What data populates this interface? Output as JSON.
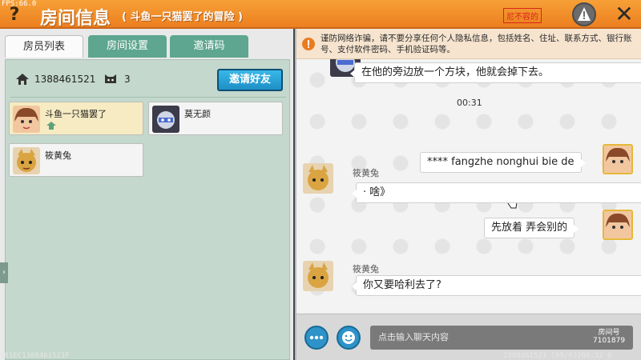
{
  "fps": "FPS:66.0",
  "header": {
    "help_icon": "help-icon",
    "title": "房间信息",
    "subtitle": "( 斗鱼一只猫罢了的冒险 )",
    "link_label": "尼不容的",
    "warn_icon": "warning-icon",
    "close_icon": "close-icon",
    "accent": "#f39a2e"
  },
  "tabs": [
    {
      "label": "房员列表"
    },
    {
      "label": "房间设置"
    },
    {
      "label": "邀请码"
    }
  ],
  "room": {
    "id": "1388461521",
    "count": "3",
    "invite_label": "邀请好友"
  },
  "members": [
    {
      "name": "斗鱼一只猫罢了",
      "role": "owner"
    },
    {
      "name": "莫无颜",
      "role": "member"
    },
    {
      "name": "筱黄兔",
      "role": "member"
    }
  ],
  "notice": "谨防网络诈骗，请不要分享任何个人隐私信息，包括姓名、住址、联系方式、银行账号、支付软件密码、手机验证码等。",
  "messages": [
    {
      "text": "在他的旁边放一个方块，他就会掉下去。"
    },
    {
      "time": "00:31"
    },
    {
      "text": "**** fangzhe  nonghui bie de"
    },
    {
      "sender": "筱黄兔",
      "text": "· 啥》"
    },
    {
      "text": "先放着 弄会别的"
    },
    {
      "sender": "筱黄兔",
      "text": "你又要哈利去了?"
    }
  ],
  "input": {
    "placeholder": "点击输入聊天内容",
    "watermark_top": "房间号",
    "watermark_id": "7101879"
  },
  "footer": {
    "left": "O81EC1388461521F",
    "right": "1388461521  [09/03]00:32 0  [102]1.3.2"
  }
}
